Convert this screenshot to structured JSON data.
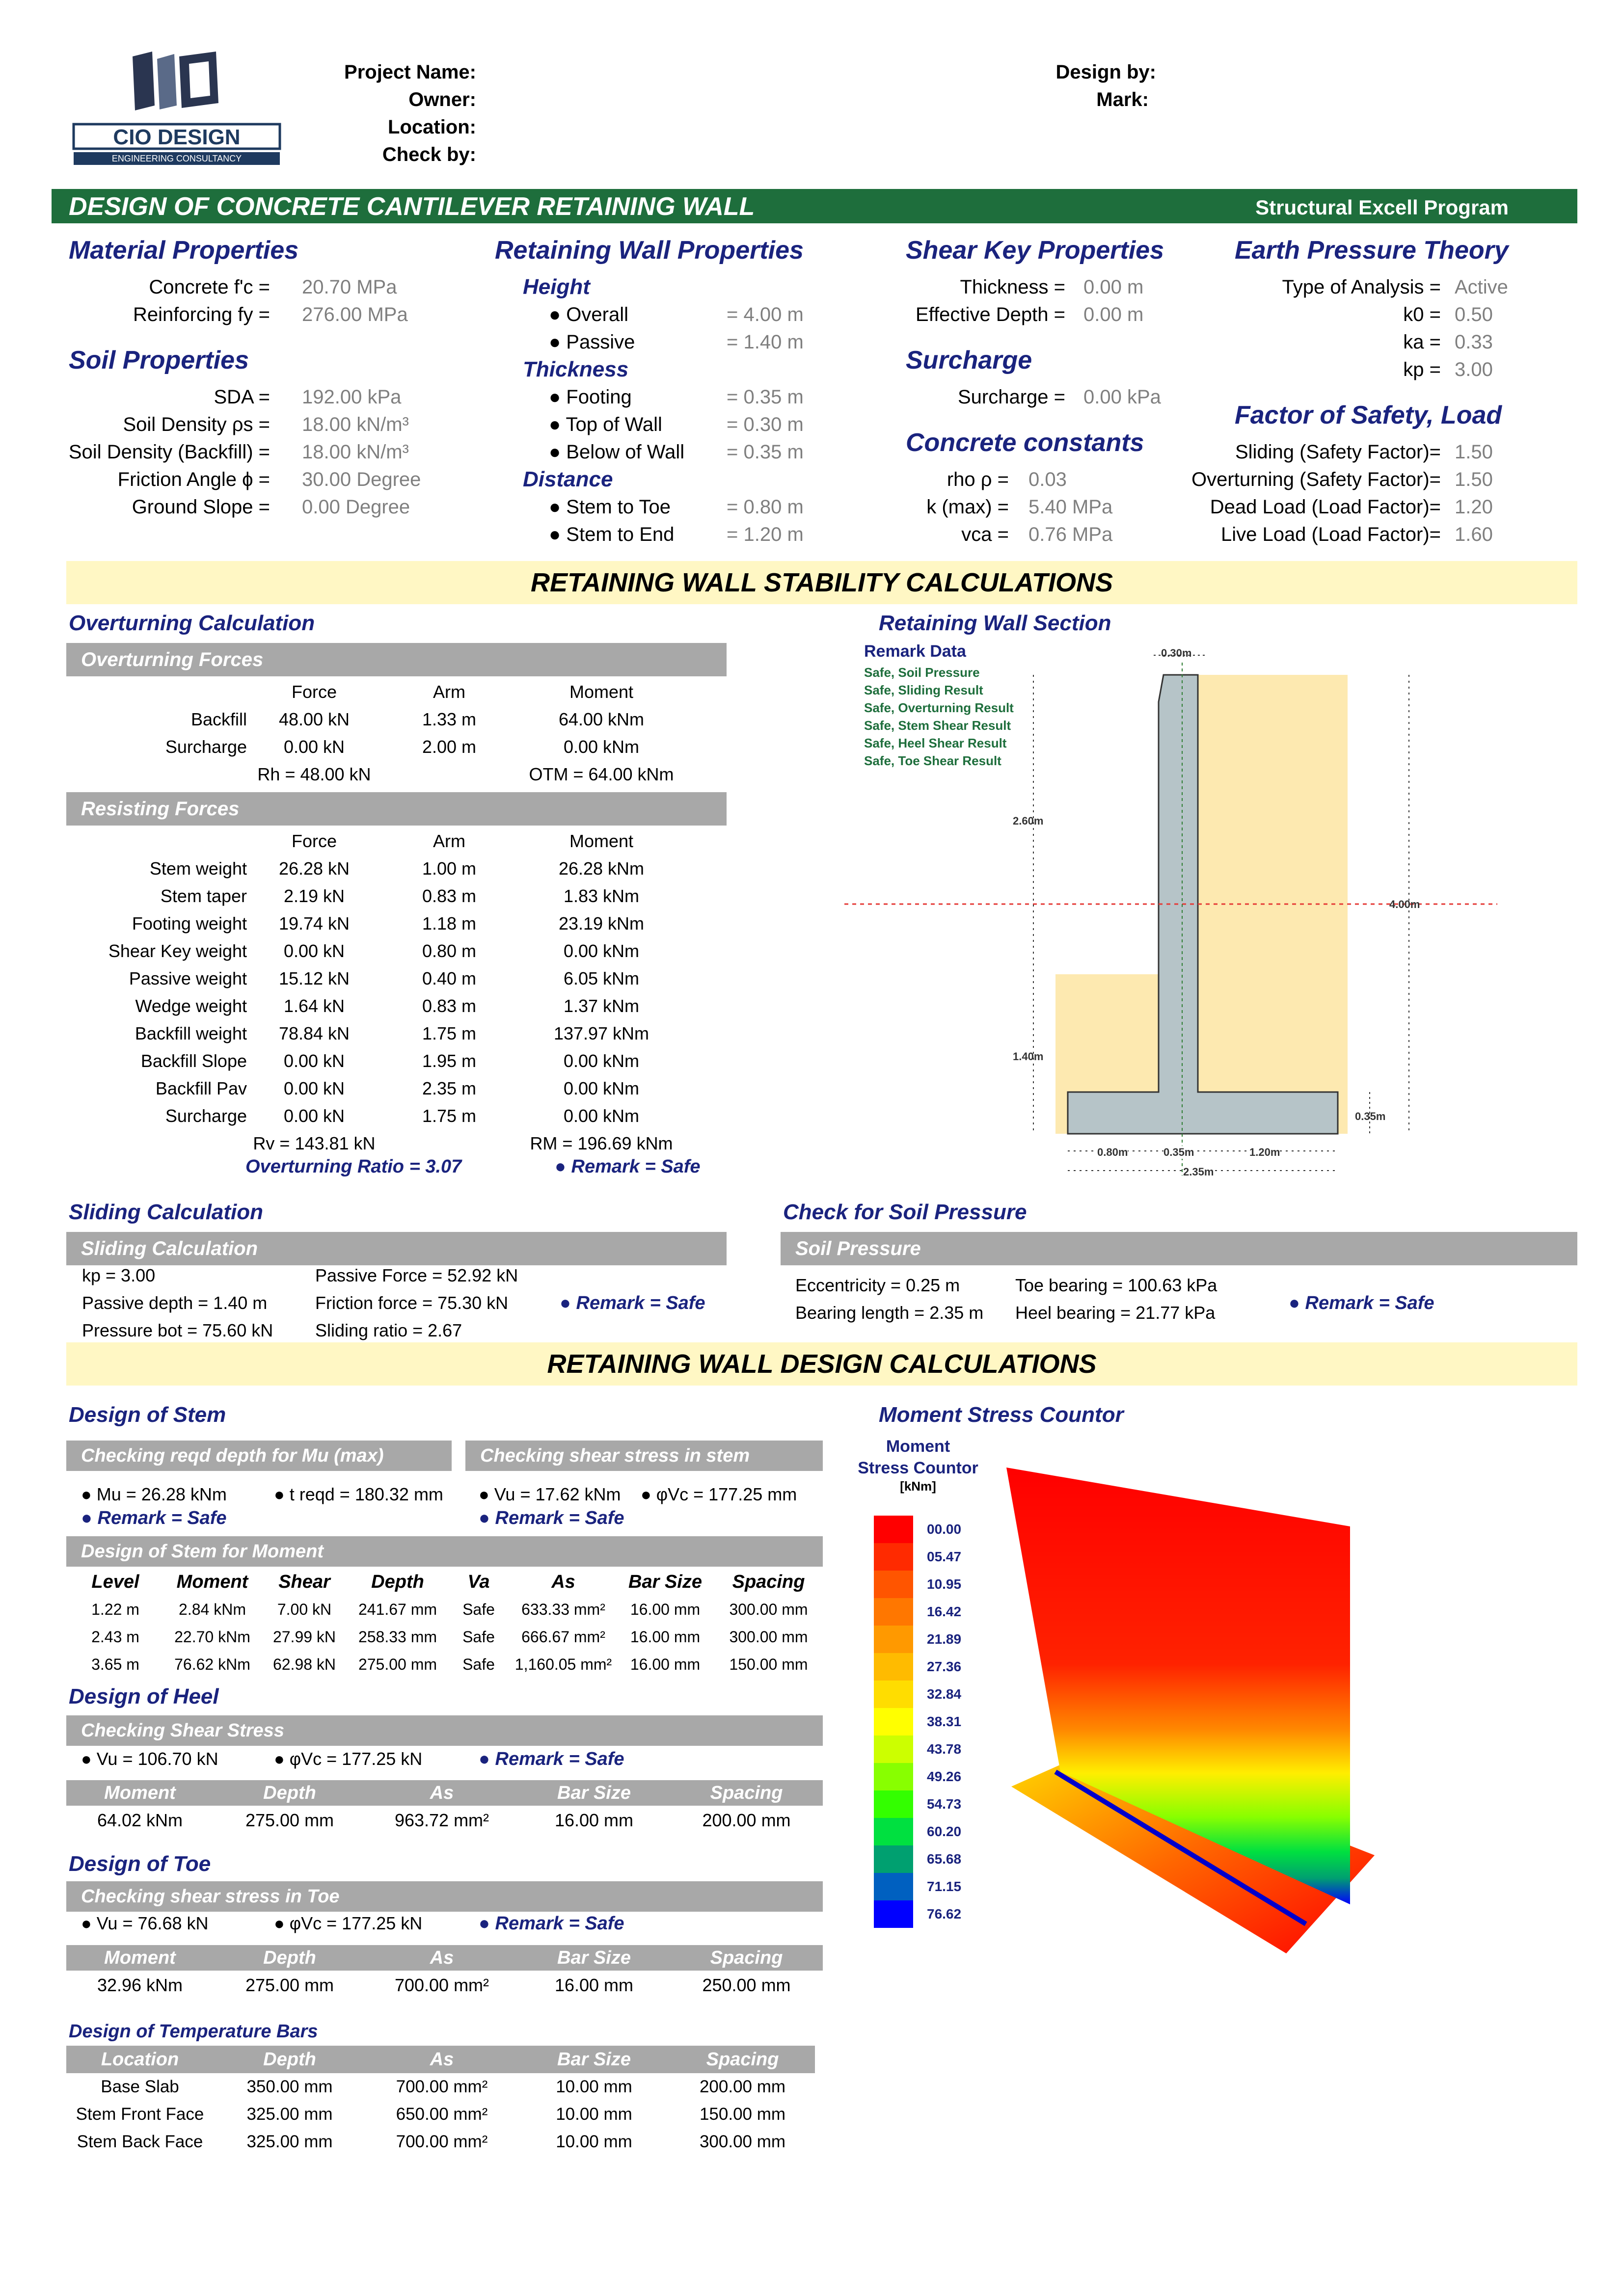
{
  "header": {
    "logo_text": "CIO DESIGN",
    "logo_sub": "ENGINEERING CONSULTANCY",
    "left_labels": [
      "Project Name:",
      "Owner:",
      "Location:",
      "Check by:"
    ],
    "right_labels": [
      "Design by:",
      "Mark:"
    ]
  },
  "title_bar": {
    "title": "DESIGN OF CONCRETE CANTILEVER RETAINING WALL",
    "program": "Structural Excell Program"
  },
  "material": {
    "heading": "Material Properties",
    "rows": [
      {
        "label": "Concrete f'c =",
        "value": "20.70 MPa"
      },
      {
        "label": "Reinforcing fy =",
        "value": "276.00 MPa"
      }
    ]
  },
  "soil": {
    "heading": "Soil Properties",
    "rows": [
      {
        "label": "SDA =",
        "value": "192.00 kPa"
      },
      {
        "label": "Soil Density ρs =",
        "value": "18.00 kN/m³"
      },
      {
        "label": "Soil Density (Backfill) =",
        "value": "18.00 kN/m³"
      },
      {
        "label": "Friction Angle ϕ =",
        "value": "30.00 Degree"
      },
      {
        "label": "Ground Slope =",
        "value": "0.00 Degree"
      }
    ]
  },
  "wall_props": {
    "heading": "Retaining Wall Properties",
    "height_heading": "Height",
    "height_rows": [
      {
        "label": "● Overall",
        "value": "= 4.00 m"
      },
      {
        "label": "● Passive",
        "value": "= 1.40 m"
      }
    ],
    "thickness_heading": "Thickness",
    "thickness_rows": [
      {
        "label": "● Footing",
        "value": "= 0.35 m"
      },
      {
        "label": "● Top of Wall",
        "value": "= 0.30 m"
      },
      {
        "label": "● Below of Wall",
        "value": "= 0.35 m"
      }
    ],
    "distance_heading": "Distance",
    "distance_rows": [
      {
        "label": "● Stem to Toe",
        "value": "= 0.80 m"
      },
      {
        "label": "● Stem to End",
        "value": "= 1.20 m"
      }
    ]
  },
  "shear_key": {
    "heading": "Shear Key Properties",
    "rows": [
      {
        "label": "Thickness =",
        "value": "0.00 m"
      },
      {
        "label": "Effective Depth =",
        "value": "0.00 m"
      }
    ],
    "surcharge_heading": "Surcharge",
    "surcharge": {
      "label": "Surcharge =",
      "value": "0.00 kPa"
    },
    "concrete_heading": "Concrete constants",
    "concrete_rows": [
      {
        "label": "rho ρ =",
        "value": "0.03"
      },
      {
        "label": "k (max) =",
        "value": "5.40 MPa"
      },
      {
        "label": "vca =",
        "value": "0.76 MPa"
      }
    ]
  },
  "earth": {
    "heading": "Earth Pressure Theory",
    "rows": [
      {
        "label": "Type of Analysis =",
        "value": "Active"
      },
      {
        "label": "k0 =",
        "value": "0.50"
      },
      {
        "label": "ka =",
        "value": "0.33"
      },
      {
        "label": "kp =",
        "value": "3.00"
      }
    ],
    "fs_heading": "Factor of Safety, Load",
    "fs_rows": [
      {
        "label": "Sliding (Safety Factor)=",
        "value": "1.50"
      },
      {
        "label": "Overturning (Safety Factor)=",
        "value": "1.50"
      },
      {
        "label": "Dead Load (Load Factor)=",
        "value": "1.20"
      },
      {
        "label": "Live Load (Load Factor)=",
        "value": "1.60"
      }
    ]
  },
  "stability_banner": "RETAINING WALL STABILITY CALCULATIONS",
  "overturning": {
    "heading": "Overturning Calculation",
    "forces_bar": "Overturning Forces",
    "cols": [
      "Force",
      "Arm",
      "Moment"
    ],
    "rows": [
      {
        "name": "Backfill",
        "force": "48.00 kN",
        "arm": "1.33 m",
        "moment": "64.00 kNm"
      },
      {
        "name": "Surcharge",
        "force": "0.00 kN",
        "arm": "2.00 m",
        "moment": "0.00 kNm"
      }
    ],
    "rh": "Rh = 48.00 kN",
    "otm": "OTM = 64.00 kNm",
    "resisting_bar": "Resisting Forces",
    "res_rows": [
      {
        "name": "Stem weight",
        "force": "26.28 kN",
        "arm": "1.00 m",
        "moment": "26.28 kNm"
      },
      {
        "name": "Stem taper",
        "force": "2.19 kN",
        "arm": "0.83 m",
        "moment": "1.83 kNm"
      },
      {
        "name": "Footing weight",
        "force": "19.74 kN",
        "arm": "1.18 m",
        "moment": "23.19 kNm"
      },
      {
        "name": "Shear Key weight",
        "force": "0.00 kN",
        "arm": "0.80 m",
        "moment": "0.00 kNm"
      },
      {
        "name": "Passive weight",
        "force": "15.12 kN",
        "arm": "0.40 m",
        "moment": "6.05 kNm"
      },
      {
        "name": "Wedge weight",
        "force": "1.64 kN",
        "arm": "0.83 m",
        "moment": "1.37 kNm"
      },
      {
        "name": "Backfill weight",
        "force": "78.84 kN",
        "arm": "1.75 m",
        "moment": "137.97 kNm"
      },
      {
        "name": "Backfill Slope",
        "force": "0.00 kN",
        "arm": "1.95 m",
        "moment": "0.00 kNm"
      },
      {
        "name": "Backfill Pav",
        "force": "0.00 kN",
        "arm": "2.35 m",
        "moment": "0.00 kNm"
      },
      {
        "name": "Surcharge",
        "force": "0.00 kN",
        "arm": "1.75 m",
        "moment": "0.00 kNm"
      }
    ],
    "rv": "Rv = 143.81 kN",
    "rm": "RM = 196.69 kNm",
    "ratio": "Overturning Ratio = 3.07",
    "remark": "● Remark = Safe"
  },
  "section": {
    "heading": "Retaining Wall Section",
    "remark_heading": "Remark Data",
    "remarks": [
      "Safe, Soil Pressure",
      "Safe, Sliding Result",
      "Safe, Overturning Result",
      "Safe, Stem Shear Result",
      "Safe, Heel  Shear Result",
      "Safe, Toe   Shear Result"
    ],
    "dims": {
      "top": "0.30m",
      "h_upper": "2.60m",
      "overall": "4.00m",
      "passive": "1.40m",
      "footing": "0.35m",
      "toe": "0.80m",
      "stem": "0.35m",
      "heel": "1.20m",
      "base": "2.35m"
    }
  },
  "sliding": {
    "heading": "Sliding Calculation",
    "bar": "Sliding Calculation",
    "col1": [
      "kp  = 3.00",
      "Passive depth = 1.40 m",
      "Pressure bot = 75.60 kN"
    ],
    "col2": [
      "Passive Force = 52.92 kN",
      "Friction force = 75.30 kN",
      "Sliding ratio = 2.67"
    ],
    "remark": "● Remark = Safe"
  },
  "soil_pressure": {
    "heading": "Check for Soil Pressure",
    "bar": "Soil Pressure",
    "col1": [
      "Eccentricity = 0.25 m",
      "Bearing length = 2.35 m"
    ],
    "col2": [
      "Toe bearing = 100.63 kPa",
      "Heel bearing = 21.77 kPa"
    ],
    "remark": "● Remark = Safe"
  },
  "design_banner": "RETAINING WALL DESIGN CALCULATIONS",
  "stem": {
    "heading": "Design of Stem",
    "bar1": "Checking reqd depth for Mu (max)",
    "bar2": "Checking shear stress in stem",
    "mu": "● Mu = 26.28 kNm",
    "treqd": "● t reqd = 180.32 mm",
    "remark1": "● Remark = Safe",
    "vu": "● Vu = 17.62 kNm",
    "phivc": "● φVc = 177.25 mm",
    "remark2": "● Remark = Safe",
    "moment_bar": "Design of Stem for Moment",
    "cols": [
      "Level",
      "Moment",
      "Shear",
      "Depth",
      "Va",
      "As",
      "Bar Size",
      "Spacing"
    ],
    "rows": [
      [
        "1.22 m",
        "2.84 kNm",
        "7.00 kN",
        "241.67 mm",
        "Safe",
        "633.33 mm²",
        "16.00 mm",
        "300.00 mm"
      ],
      [
        "2.43 m",
        "22.70 kNm",
        "27.99 kN",
        "258.33 mm",
        "Safe",
        "666.67 mm²",
        "16.00 mm",
        "300.00 mm"
      ],
      [
        "3.65 m",
        "76.62 kNm",
        "62.98 kN",
        "275.00 mm",
        "Safe",
        "1,160.05 mm²",
        "16.00 mm",
        "150.00 mm"
      ]
    ]
  },
  "heel": {
    "heading": "Design of Heel",
    "bar": "Checking Shear Stress",
    "vu": "● Vu = 106.70 kN",
    "phivc": "● φVc = 177.25 kN",
    "remark": "● Remark = Safe",
    "cols": [
      "Moment",
      "Depth",
      "As",
      "Bar Size",
      "Spacing"
    ],
    "row": [
      "64.02 kNm",
      "275.00 mm",
      "963.72 mm²",
      "16.00 mm",
      "200.00 mm"
    ]
  },
  "toe": {
    "heading": "Design of Toe",
    "bar": "Checking shear stress in Toe",
    "vu": "● Vu = 76.68 kN",
    "phivc": "● φVc = 177.25 kN",
    "remark": "● Remark = Safe",
    "cols": [
      "Moment",
      "Depth",
      "As",
      "Bar Size",
      "Spacing"
    ],
    "row": [
      "32.96 kNm",
      "275.00 mm",
      "700.00 mm²",
      "16.00 mm",
      "250.00 mm"
    ]
  },
  "temp": {
    "heading": "Design of Temperature Bars",
    "cols": [
      "Location",
      "Depth",
      "As",
      "Bar Size",
      "Spacing"
    ],
    "rows": [
      [
        "Base Slab",
        "350.00 mm",
        "700.00 mm²",
        "10.00 mm",
        "200.00 mm"
      ],
      [
        "Stem Front Face",
        "325.00 mm",
        "650.00 mm²",
        "10.00 mm",
        "150.00 mm"
      ],
      [
        "Stem Back Face",
        "325.00 mm",
        "700.00 mm²",
        "10.00 mm",
        "300.00 mm"
      ]
    ]
  },
  "stress": {
    "heading": "Moment Stress Countor",
    "legend_title": [
      "Moment",
      "Stress Countor",
      "[kNm]"
    ],
    "legend_values": [
      "00.00",
      "05.47",
      "10.95",
      "16.42",
      "21.89",
      "27.36",
      "32.84",
      "38.31",
      "43.78",
      "49.26",
      "54.73",
      "60.20",
      "65.68",
      "71.15",
      "76.62"
    ],
    "legend_colors": [
      "#ff0000",
      "#ff2a00",
      "#ff5500",
      "#ff7700",
      "#ff9900",
      "#ffbb00",
      "#ffdd00",
      "#ffff00",
      "#ccff00",
      "#88ff00",
      "#33ff00",
      "#00e040",
      "#00a070",
      "#0060c0",
      "#0000ff"
    ]
  }
}
